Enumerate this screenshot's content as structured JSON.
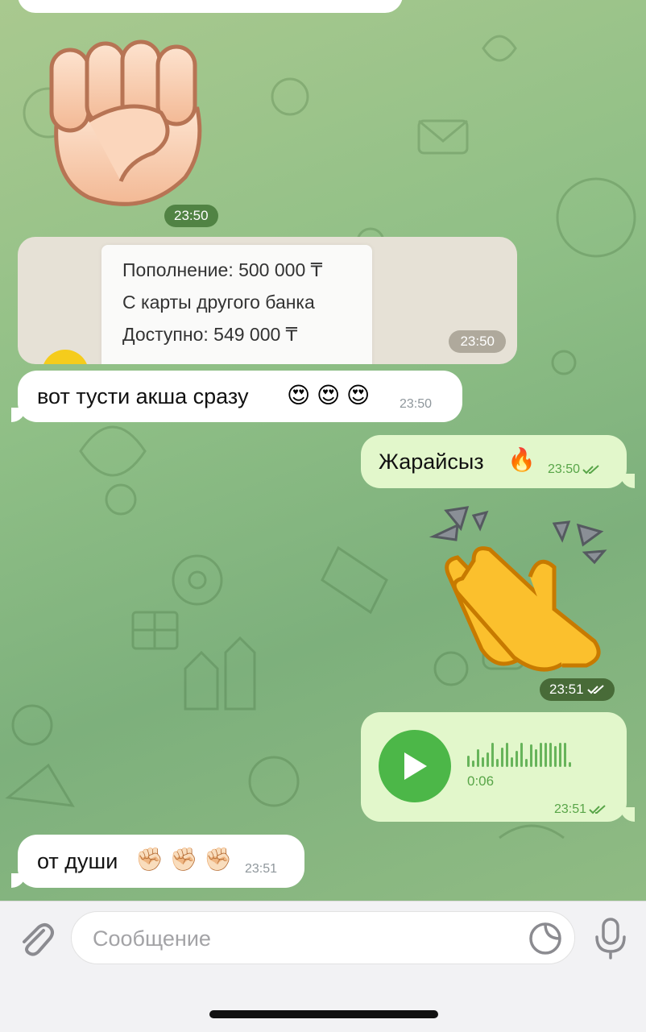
{
  "colors": {
    "incoming_bubble": "#ffffff",
    "outgoing_bubble": "#e2f7cb",
    "accent_green": "#4cb748",
    "chat_background": "#8fbf86"
  },
  "messages": [
    {
      "type": "sticker",
      "direction": "in",
      "emoji": "✊",
      "time": "23:50"
    },
    {
      "type": "photo",
      "direction": "in",
      "time": "23:50",
      "receipt_lines": [
        "Пополнение: 500 000 ₸",
        "С карты другого банка",
        "Доступно: 549 000 ₸"
      ]
    },
    {
      "type": "text",
      "direction": "in",
      "text": "вот тусти акша сразу",
      "emojis": "😍 😍 😍",
      "time": "23:50"
    },
    {
      "type": "text",
      "direction": "out",
      "text": "Жарайсыз",
      "emojis": "🔥",
      "time": "23:50",
      "status_icon": "double-check-icon"
    },
    {
      "type": "sticker",
      "direction": "out",
      "emoji": "👏",
      "time": "23:51",
      "status_icon": "double-check-icon"
    },
    {
      "type": "voice",
      "direction": "out",
      "duration": "0:06",
      "time": "23:51",
      "status_icon": "double-check-icon"
    },
    {
      "type": "text",
      "direction": "in",
      "text": "от души",
      "emojis": "✊🏻 ✊🏻 ✊🏻",
      "time": "23:51"
    }
  ],
  "composer": {
    "placeholder": "Сообщение",
    "icons": [
      "paperclip-icon",
      "sticker-icon",
      "microphone-icon"
    ]
  }
}
